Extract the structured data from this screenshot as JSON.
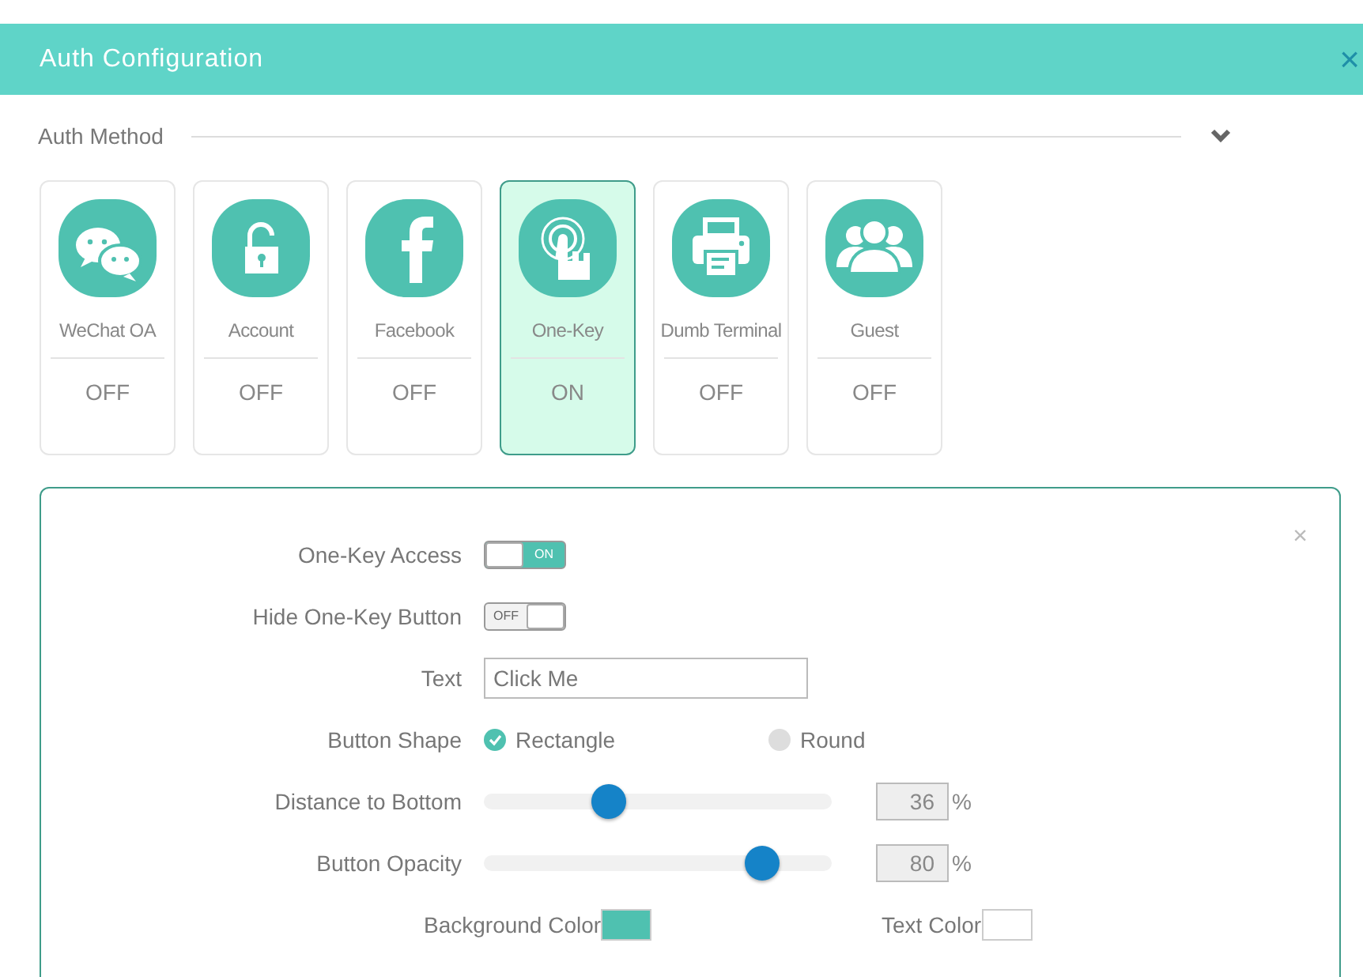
{
  "window": {
    "title": "Auth Configuration",
    "close": "×"
  },
  "section": {
    "title": "Auth Method",
    "expanded": true
  },
  "methods": [
    {
      "label": "WeChat OA",
      "kind": "chat",
      "status": "OFF",
      "selected": false
    },
    {
      "label": "Account",
      "kind": "lock",
      "status": "OFF",
      "selected": false
    },
    {
      "label": "Facebook",
      "kind": "facebook",
      "status": "OFF",
      "selected": false
    },
    {
      "label": "One-Key",
      "kind": "touch",
      "status": "ON",
      "selected": true
    },
    {
      "label": "Dumb Terminal",
      "kind": "printer",
      "status": "OFF",
      "selected": false
    },
    {
      "label": "Guest",
      "kind": "group",
      "status": "OFF",
      "selected": false
    }
  ],
  "panel": {
    "close": "×",
    "toggles": [
      {
        "label": "One-Key Access",
        "on": true,
        "on_text": "ON"
      },
      {
        "label": "Hide One-Key Button",
        "on": false,
        "off_text": "OFF"
      }
    ],
    "text_field": {
      "label": "Text",
      "value": "Click Me"
    },
    "shape": {
      "label": "Button Shape",
      "options": [
        {
          "label": "Rectangle",
          "selected": true
        },
        {
          "label": "Round",
          "selected": false
        }
      ]
    },
    "sliders": [
      {
        "label": "Distance to Bottom",
        "level": 0.36,
        "value": "36",
        "unit": "%"
      },
      {
        "label": "Button Opacity",
        "level": 0.8,
        "value": "80",
        "unit": "%"
      }
    ],
    "colors": [
      {
        "label": "Background Color",
        "color": "#4fc1b0"
      },
      {
        "label": "Text Color",
        "color": "#ffffff"
      }
    ]
  }
}
